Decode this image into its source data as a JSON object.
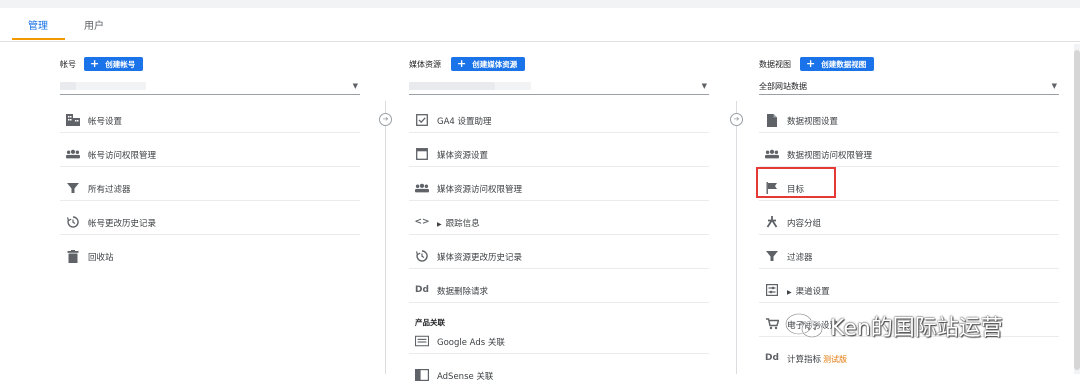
{
  "tabs": [
    {
      "label": "管理",
      "active": true
    },
    {
      "label": "用户",
      "active": false
    }
  ],
  "columns": {
    "account": {
      "label": "帐号",
      "create_button": "创建帐号",
      "selector_value": "",
      "items": [
        {
          "icon": "building-icon",
          "label": "帐号设置"
        },
        {
          "icon": "people-icon",
          "label": "帐号访问权限管理"
        },
        {
          "icon": "filter-icon",
          "label": "所有过滤器"
        },
        {
          "icon": "history-icon",
          "label": "帐号更改历史记录"
        },
        {
          "icon": "trash-icon",
          "label": "回收站"
        }
      ]
    },
    "property": {
      "label": "媒体资源",
      "create_button": "创建媒体资源",
      "selector_value": "",
      "items": [
        {
          "icon": "checkbox-icon",
          "label": "GA4 设置助理"
        },
        {
          "icon": "window-icon",
          "label": "媒体资源设置"
        },
        {
          "icon": "people-icon",
          "label": "媒体资源访问权限管理"
        },
        {
          "icon": "code-icon",
          "label": "跟踪信息"
        },
        {
          "icon": "history-icon",
          "label": "媒体资源更改历史记录"
        },
        {
          "icon": "dd-icon",
          "label": "数据删除请求"
        }
      ],
      "section_title": "产品关联",
      "product_links": [
        {
          "icon": "ads-icon",
          "label": "Google Ads 关联"
        },
        {
          "icon": "adsense-icon",
          "label": "AdSense 关联"
        }
      ]
    },
    "view": {
      "label": "数据视图",
      "create_button": "创建数据视图",
      "selector_value": "全部网站数据",
      "items": [
        {
          "icon": "document-icon",
          "label": "数据视图设置"
        },
        {
          "icon": "people-icon",
          "label": "数据视图访问权限管理"
        },
        {
          "icon": "flag-icon",
          "label": "目标"
        },
        {
          "icon": "person-walking-icon",
          "label": "内容分组"
        },
        {
          "icon": "filter-icon",
          "label": "过滤器"
        },
        {
          "icon": "channel-icon",
          "label": "渠道设置"
        },
        {
          "icon": "cart-icon",
          "label": "电子商务设置"
        },
        {
          "icon": "dd-icon",
          "label": "计算指标",
          "beta": "测试版"
        }
      ]
    }
  },
  "watermark": {
    "text": "Ken的国际站运营"
  },
  "colors": {
    "accent": "#1a73e8",
    "tab_underline": "#f29900",
    "highlight": "#e53935",
    "beta": "#e37400"
  }
}
